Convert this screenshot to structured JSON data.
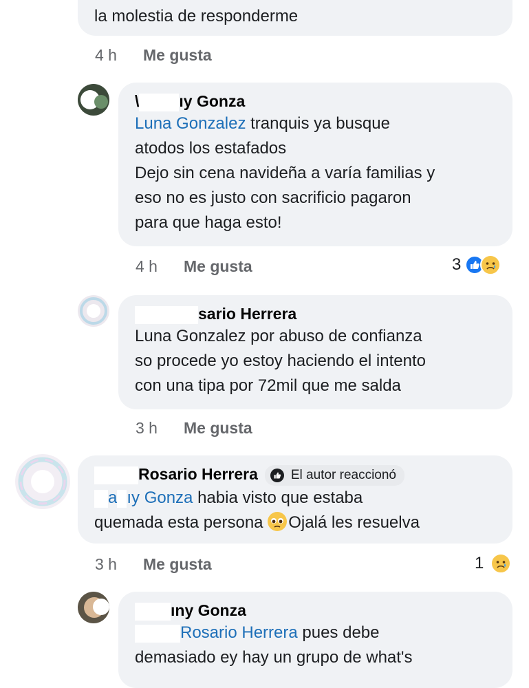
{
  "comment0": {
    "text": "la molestia de responderme",
    "time": "4 h",
    "like": "Me gusta"
  },
  "comment1": {
    "author": "\\ y Gonza",
    "author_a": "\\",
    "author_b": "ıy Gonza",
    "mention": "Luna Gonzalez",
    "line1_rest": " tranquis ya busque",
    "line2": "atodos los estafados",
    "line3": "Dejo sin cena navideña a varía familias y",
    "line4": "eso no es justo con sacrificio pagaron",
    "line5": "para que haga esto!",
    "time": "4 h",
    "like": "Me gusta",
    "reaction_count": "3",
    "reaction_icons": [
      "like-icon",
      "sad-icon"
    ]
  },
  "comment2": {
    "author": "sario Herrera",
    "line1": "Luna Gonzalez por abuso de confianza",
    "line2": "so procede yo estoy haciendo el intento",
    "line3": "con una tipa por 72mil que me salda",
    "time": "3 h",
    "like": "Me gusta"
  },
  "comment3": {
    "author": "Rosario Herrera",
    "badge": "El autor reaccionó",
    "mention_a": "a",
    "mention_b": "ıy Gonza",
    "line1_rest": " habia visto que estaba",
    "line2_a": "quemada esta persona ",
    "line2_b": "Ojalá les resuelva",
    "time": "3 h",
    "like": "Me gusta",
    "reaction_count": "1",
    "reaction_icons": [
      "sad-icon"
    ]
  },
  "comment4": {
    "author": "ıny Gonza",
    "mention": "Rosario Herrera",
    "line1_rest": " pues debe",
    "line2": "demasiado ey hay un grupo de what's"
  },
  "colors": {
    "mention": "#1d6fb8",
    "bubble": "#f0f2f5",
    "meta": "#65676b",
    "like_reaction": "#1877f2",
    "sad_reaction": "#f7c64a"
  }
}
